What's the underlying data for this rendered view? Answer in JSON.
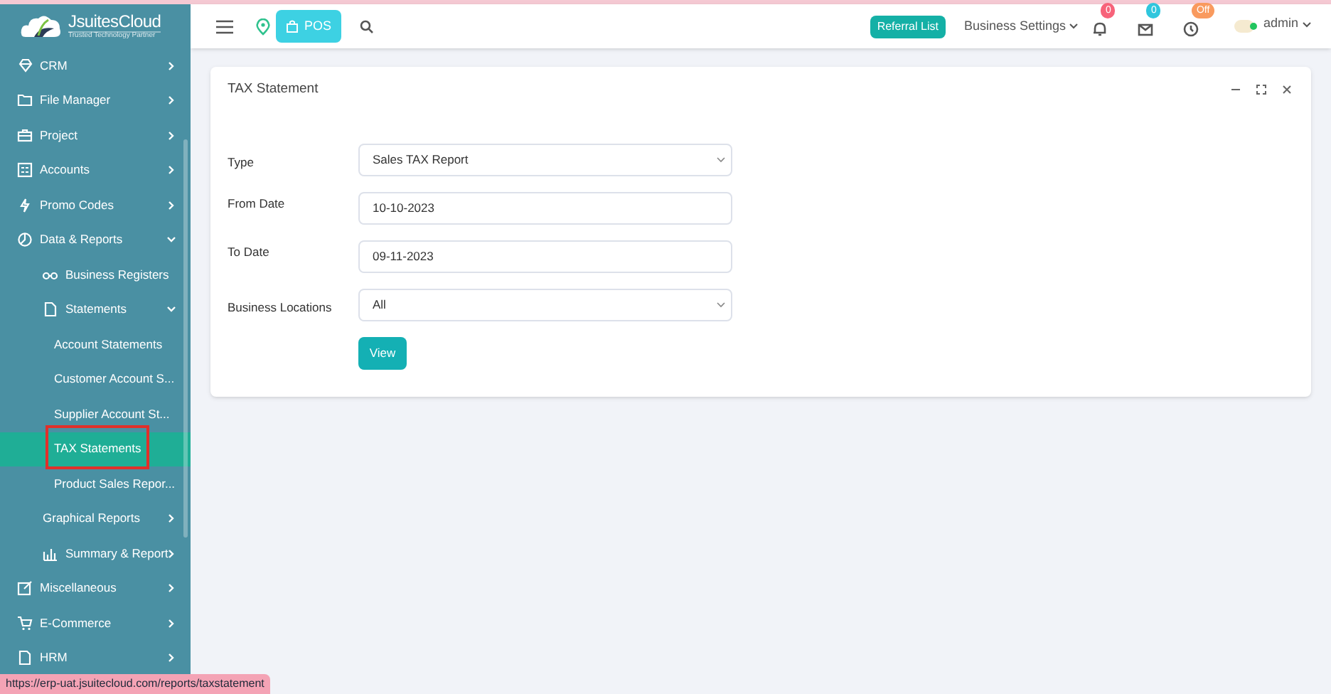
{
  "logo": {
    "name": "JsuitesCloud",
    "tagline": "Trusted Technology Partner"
  },
  "sidebar": {
    "items": [
      {
        "label": "CRM",
        "expanded": false,
        "selected": false
      },
      {
        "label": "File Manager",
        "expanded": false,
        "selected": false
      },
      {
        "label": "Project",
        "expanded": false,
        "selected": false
      },
      {
        "label": "Accounts",
        "expanded": false,
        "selected": false
      },
      {
        "label": "Promo Codes",
        "expanded": false,
        "selected": false
      },
      {
        "label": "Data & Reports",
        "expanded": true,
        "selected": false,
        "children": [
          {
            "label": "Business Registers",
            "selected": false
          },
          {
            "label": "Statements",
            "expanded": true,
            "selected": false,
            "children": [
              {
                "label": "Account Statements",
                "selected": false
              },
              {
                "label": "Customer Account S...",
                "selected": false
              },
              {
                "label": "Supplier Account St...",
                "selected": false
              },
              {
                "label": "TAX Statements",
                "selected": true,
                "highlighted": true
              },
              {
                "label": "Product Sales Repor...",
                "selected": false
              }
            ]
          },
          {
            "label": "Graphical Reports",
            "expanded": false,
            "selected": false
          },
          {
            "label": "Summary & Report",
            "expanded": false,
            "selected": false
          }
        ]
      },
      {
        "label": "Miscellaneous",
        "expanded": false,
        "selected": false
      },
      {
        "label": "E-Commerce",
        "expanded": false,
        "selected": false
      },
      {
        "label": "HRM",
        "expanded": false,
        "selected": false
      }
    ]
  },
  "header": {
    "pos_button": "POS",
    "referral": "Referral List",
    "business_settings": "Business Settings",
    "notifications": "0",
    "messages": "0",
    "clock_status": "Off",
    "user": "admin"
  },
  "card": {
    "title": "TAX Statement",
    "fields": [
      {
        "kind": "select",
        "label": "Type",
        "value": "Sales TAX Report"
      },
      {
        "kind": "input",
        "label": "From Date",
        "value": "10-10-2023"
      },
      {
        "kind": "input",
        "label": "To Date",
        "value": "09-11-2023"
      },
      {
        "kind": "select",
        "label": "Business Locations",
        "value": "All"
      }
    ],
    "submit": "View"
  },
  "status_url": "https://erp-uat.jsuitecloud.com/reports/taxstatement"
}
